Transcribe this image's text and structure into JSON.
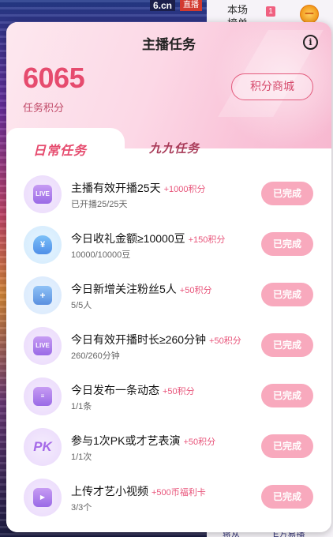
{
  "background": {
    "site_tag": "6.cn",
    "live_tag": "直播",
    "rank_label": "本场\n榜单",
    "rank_number": "1",
    "badge_text": "一",
    "bottom_text_left": "蒋从",
    "bottom_text_right": "E方易播"
  },
  "popup": {
    "title": "主播任务",
    "info_icon": "i",
    "points_value": "6065",
    "points_label": "任务积分",
    "mall_button": "积分商城"
  },
  "tabs": {
    "active": "日常任务",
    "inactive": "九九任务"
  },
  "tasks": [
    {
      "icon": "live-tv-icon",
      "icon_text": "LIVE",
      "title": "主播有效开播25天",
      "reward": "+1000积分",
      "progress": "已开播25/25天",
      "status": "已完成"
    },
    {
      "icon": "money-bag-icon",
      "icon_text": "¥",
      "title": "今日收礼金额≥10000豆",
      "reward": "+150积分",
      "progress": "10000/10000豆",
      "status": "已完成"
    },
    {
      "icon": "add-fans-icon",
      "icon_text": "+",
      "title": "今日新增关注粉丝5人",
      "reward": "+50积分",
      "progress": "5/5人",
      "status": "已完成"
    },
    {
      "icon": "live-tv-icon",
      "icon_text": "LIVE",
      "title": "今日有效开播时长≥260分钟",
      "reward": "+50积分",
      "progress": "260/260分钟",
      "status": "已完成"
    },
    {
      "icon": "post-icon",
      "icon_text": "≡",
      "title": "今日发布一条动态",
      "reward": "+50积分",
      "progress": "1/1条",
      "status": "已完成"
    },
    {
      "icon": "pk-icon",
      "icon_text": "PK",
      "title": "参与1次PK或才艺表演",
      "reward": "+50积分",
      "progress": "1/1次",
      "status": "已完成"
    },
    {
      "icon": "video-icon",
      "icon_text": "▶",
      "title": "上传才艺小视频",
      "reward": "+500币福利卡",
      "progress": "3/3个",
      "status": "已完成"
    }
  ],
  "colors": {
    "accent": "#e64b6e",
    "done_button": "#f8a9bd",
    "header_gradient_start": "#fde8ef",
    "header_gradient_end": "#f7b8d0"
  }
}
